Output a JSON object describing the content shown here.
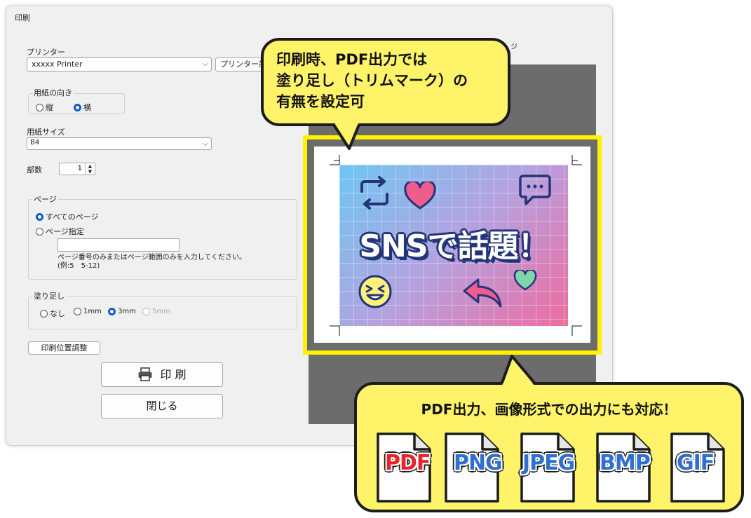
{
  "dialog": {
    "title": "印刷",
    "printer_label": "プリンター",
    "printer_value": "xxxxx Printer",
    "printer_settings_button": "プリンター設",
    "preview_label_partial": "ジ",
    "orientation": {
      "label": "用紙の向き",
      "options": [
        "縦",
        "横"
      ],
      "selected": "横"
    },
    "paper_size": {
      "label": "用紙サイズ",
      "value": "B4"
    },
    "copies": {
      "label": "部数",
      "value": "1"
    },
    "page": {
      "label": "ページ",
      "all_pages": "すべてのページ",
      "specify_pages": "ページ指定",
      "specify_value": "",
      "hint_line1": "ページ番号のみまたはページ範囲のみを入力してください。",
      "hint_line2": "(例:5　5-12)"
    },
    "bleed": {
      "label": "塗り足し",
      "options": [
        "なし",
        "1mm",
        "3mm",
        "5mm"
      ],
      "selected": "3mm",
      "disabled": [
        "5mm"
      ]
    },
    "position_adjust_button": "印刷位置調整",
    "print_button": "印 刷",
    "close_button": "閉じる"
  },
  "preview": {
    "artwork_text": "SNSで話題！"
  },
  "callout_top": {
    "lines": [
      "印刷時、PDF出力では",
      "塗り足し（トリムマーク）の",
      "有無を設定可"
    ]
  },
  "callout_bottom": {
    "text": "PDF出力、画像形式での出力にも対応！",
    "formats": [
      {
        "label": "PDF",
        "color": "#e8232a"
      },
      {
        "label": "PNG",
        "color": "#2f6fd0"
      },
      {
        "label": "JPEG",
        "color": "#2f6fd0"
      },
      {
        "label": "BMP",
        "color": "#2f6fd0"
      },
      {
        "label": "GIF",
        "color": "#2f6fd0"
      }
    ]
  },
  "colors": {
    "highlight_yellow": "#fff200",
    "bubble_yellow": "#fff36a",
    "radio_selected": "#0a5fc2"
  },
  "icons": [
    "printer-icon",
    "dropdown-arrow-icon",
    "spinner-icon",
    "refresh-icon",
    "heart-icon",
    "chat-icon",
    "smile-icon",
    "back-arrow-icon",
    "file-icon"
  ]
}
